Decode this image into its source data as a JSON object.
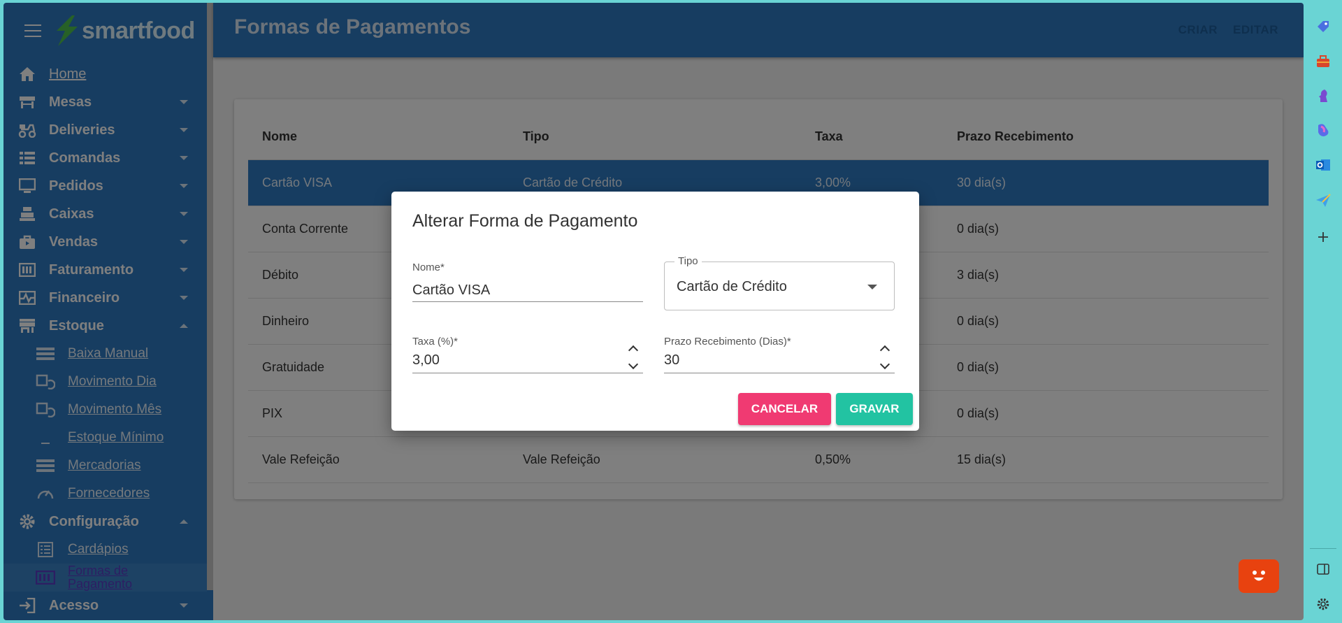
{
  "brand": {
    "name": "smartfood"
  },
  "header": {
    "title": "Formas de Pagamentos",
    "actions": [
      "CRIAR",
      "EDITAR"
    ]
  },
  "sidebar": {
    "items": [
      {
        "label": "Home",
        "icon": "home-icon",
        "link": true
      },
      {
        "label": "Mesas",
        "icon": "table-icon",
        "expand": "down"
      },
      {
        "label": "Deliveries",
        "icon": "delivery-icon",
        "expand": "down"
      },
      {
        "label": "Comandas",
        "icon": "list-icon",
        "expand": "down"
      },
      {
        "label": "Pedidos",
        "icon": "monitor-icon",
        "expand": "down"
      },
      {
        "label": "Caixas",
        "icon": "cash-register-icon",
        "expand": "down"
      },
      {
        "label": "Vendas",
        "icon": "bag-icon",
        "expand": "down"
      },
      {
        "label": "Faturamento",
        "icon": "billing-icon",
        "expand": "down"
      },
      {
        "label": "Financeiro",
        "icon": "pulse-icon",
        "expand": "down"
      },
      {
        "label": "Estoque",
        "icon": "store-icon",
        "expand": "up"
      }
    ],
    "estoque_sub": [
      {
        "label": "Baixa Manual",
        "icon": "rows-icon"
      },
      {
        "label": "Movimento Dia",
        "icon": "calendar-sync-icon"
      },
      {
        "label": "Movimento Mês",
        "icon": "calendar-sync-icon"
      },
      {
        "label": "Estoque Mínimo",
        "icon": "underscore-icon"
      },
      {
        "label": "Mercadorias",
        "icon": "rows-icon"
      },
      {
        "label": "Fornecedores",
        "icon": "gauge-icon"
      }
    ],
    "config": {
      "label": "Configuração",
      "icon": "gear-icon",
      "expand": "up"
    },
    "config_sub": [
      {
        "label": "Cardápios",
        "icon": "menu-list-icon"
      },
      {
        "label": "Formas de Pagamento",
        "icon": "payment-icon"
      }
    ],
    "acesso": {
      "label": "Acesso",
      "icon": "login-icon",
      "expand": "down"
    }
  },
  "table": {
    "columns": [
      "Nome",
      "Tipo",
      "Taxa",
      "Prazo Recebimento"
    ],
    "rows": [
      [
        "Cartão VISA",
        "Cartão de Crédito",
        "3,00%",
        "30 dia(s)"
      ],
      [
        "Conta Corrente",
        "",
        "",
        "0 dia(s)"
      ],
      [
        "Débito",
        "",
        "",
        "3 dia(s)"
      ],
      [
        "Dinheiro",
        "",
        "",
        "0 dia(s)"
      ],
      [
        "Gratuidade",
        "",
        "",
        "0 dia(s)"
      ],
      [
        "PIX",
        "",
        "",
        "0 dia(s)"
      ],
      [
        "Vale Refeição",
        "Vale Refeição",
        "0,50%",
        "15 dia(s)"
      ]
    ]
  },
  "dialog": {
    "title": "Alterar Forma de Pagamento",
    "nome_label": "Nome*",
    "nome_value": "Cartão VISA",
    "tipo_label": "Tipo",
    "tipo_value": "Cartão de Crédito",
    "taxa_label": "Taxa (%)*",
    "taxa_value": "3,00",
    "prazo_label": "Prazo Recebimento (Dias)*",
    "prazo_value": "30",
    "cancel_label": "CANCELAR",
    "save_label": "GRAVAR"
  },
  "colors": {
    "primary": "#2f7ac2",
    "cancel": "#f03a72",
    "save": "#22c3a2",
    "frame": "#6ad4d4"
  }
}
